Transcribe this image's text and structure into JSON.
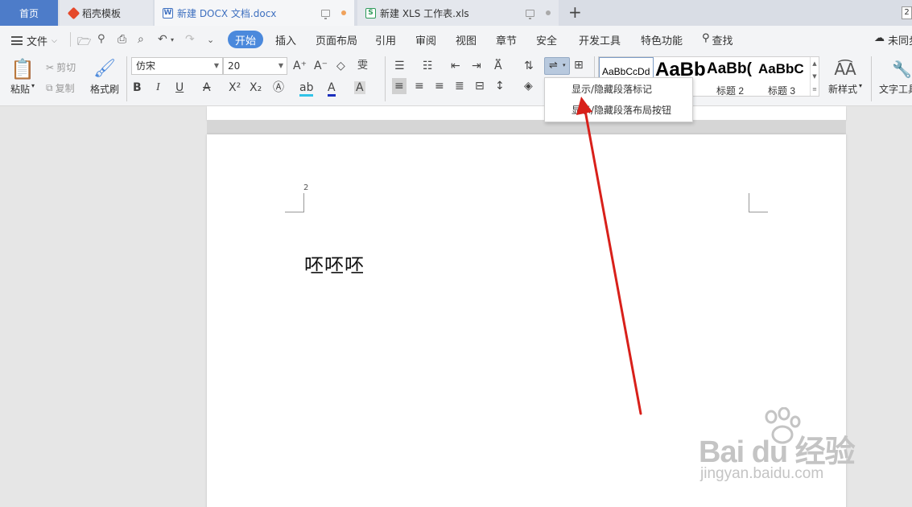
{
  "tabs": {
    "home": "首页",
    "template": "稻壳模板",
    "docx": "新建 DOCX 文档.docx",
    "xls": "新建 XLS 工作表.xls",
    "window_count": "2"
  },
  "menu": {
    "file": "文件",
    "items": [
      "开始",
      "插入",
      "页面布局",
      "引用",
      "审阅",
      "视图",
      "章节",
      "安全",
      "开发工具",
      "特色功能",
      "查找"
    ],
    "sync_status": "未同步"
  },
  "ribbon": {
    "paste": "粘贴",
    "cut": "剪切",
    "copy": "复制",
    "format_painter": "格式刷",
    "font_name": "仿宋",
    "font_size": "20",
    "new_style": "新样式",
    "text_tools": "文字工具",
    "styles": [
      {
        "sample": "AaBbCcDd",
        "label": ""
      },
      {
        "sample": "AaBb",
        "label": ""
      },
      {
        "sample": "AaBb(",
        "label": "标题 2"
      },
      {
        "sample": "AaBbC",
        "label": "标题 3"
      }
    ]
  },
  "dropdown": {
    "items": [
      "显示/隐藏段落标记",
      "显示/隐藏段落布局按钮"
    ]
  },
  "document": {
    "page_number": "2",
    "body_text": "呸呸呸"
  },
  "watermark": {
    "brand": "Bai du 经验",
    "url": "jingyan.baidu.com"
  },
  "colors": {
    "accent": "#4b89dc",
    "arrow": "#d8201a",
    "home_tab": "#4d7cc9"
  }
}
